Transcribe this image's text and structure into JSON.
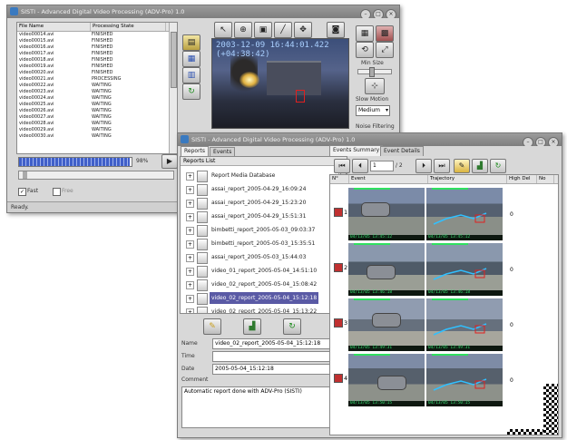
{
  "back_window": {
    "title": "SISTI - Advanced Digital Video Processing (ADV-Pro) 1.0",
    "file_list": {
      "columns": [
        "File Name",
        "Processing State"
      ],
      "rows": [
        {
          "name": "video00014.avi",
          "state": "FINISHED"
        },
        {
          "name": "video00015.avi",
          "state": "FINISHED"
        },
        {
          "name": "video00016.avi",
          "state": "FINISHED"
        },
        {
          "name": "video00017.avi",
          "state": "FINISHED"
        },
        {
          "name": "video00018.avi",
          "state": "FINISHED"
        },
        {
          "name": "video00019.avi",
          "state": "FINISHED"
        },
        {
          "name": "video00020.avi",
          "state": "FINISHED"
        },
        {
          "name": "video00021.avi",
          "state": "PROCESSING"
        },
        {
          "name": "video00022.avi",
          "state": "WAITING"
        },
        {
          "name": "video00023.avi",
          "state": "WAITING"
        },
        {
          "name": "video00024.avi",
          "state": "WAITING"
        },
        {
          "name": "video00025.avi",
          "state": "WAITING"
        },
        {
          "name": "video00026.avi",
          "state": "WAITING"
        },
        {
          "name": "video00027.avi",
          "state": "WAITING"
        },
        {
          "name": "video00028.avi",
          "state": "WAITING"
        },
        {
          "name": "video00029.avi",
          "state": "WAITING"
        },
        {
          "name": "video00030.avi",
          "state": "WAITING"
        }
      ]
    },
    "progress": {
      "value": 0.98,
      "label": "98%"
    },
    "video_timestamp_line1": "2003-12-09 16:44:01.422",
    "video_timestamp_line2": "(+04:38:42)",
    "checkbox_fast": "Fast",
    "checkbox_free": "Free",
    "status": "Ready.",
    "min_size_label": "Min Size",
    "slow_motion_label": "Slow Motion",
    "slow_motion_value": "Medium",
    "noise_filtering_label": "Noise Filtering"
  },
  "front_window": {
    "title": "SISTI - Advanced Digital Video Processing (ADV-Pro) 1.0",
    "left_tabs": [
      "Reports",
      "Events"
    ],
    "report_list_header": "Reports List",
    "reports": [
      "Report Media Database",
      "assai_report_2005-04-29_16:09:24",
      "assai_report_2005-04-29_15:23:20",
      "assai_report_2005-04-29_15:51:31",
      "bimbetti_report_2005-05-03_09:03:37",
      "bimbetti_report_2005-05-03_15:35:51",
      "assai_report_2005-05-03_15:44:03",
      "video_01_report_2005-05-04_14:51:10",
      "video_02_report_2005-05-04_15:08:42",
      "video_02_report_2005-05-04_15:12:18",
      "video_02_report_2005-05-04_15:13:22"
    ],
    "selected_report_index": 9,
    "details": {
      "name_label": "Name",
      "name_value": "video_02_report_2005-05-04_15:12:18",
      "time_label": "Time",
      "time_value": "",
      "date_label": "Date",
      "date_value": "2005-05-04_15:12:18",
      "comment_label": "Comment",
      "comment_value": "Automatic report done with ADV-Pro (SISTI)"
    },
    "right_tabs": [
      "Events Summary",
      "Event Details"
    ],
    "pager": {
      "current": "1",
      "total": "/ 2"
    },
    "event_columns": [
      "N°",
      "Event",
      "Trajectory",
      "High Del",
      "No"
    ],
    "events": [
      {
        "n": "1",
        "ts1": "04/13/05 13:45:12",
        "ts2": "04/13/05 13:45:12",
        "hd": "0"
      },
      {
        "n": "2",
        "ts1": "04/13/05 13:46:18",
        "ts2": "04/13/05 13:46:18",
        "hd": "0"
      },
      {
        "n": "3",
        "ts1": "04/13/05 13:49:31",
        "ts2": "04/13/05 13:49:31",
        "hd": "0"
      },
      {
        "n": "4",
        "ts1": "04/13/05 13:50:15",
        "ts2": "04/13/05 13:50:15",
        "hd": "0"
      }
    ]
  }
}
